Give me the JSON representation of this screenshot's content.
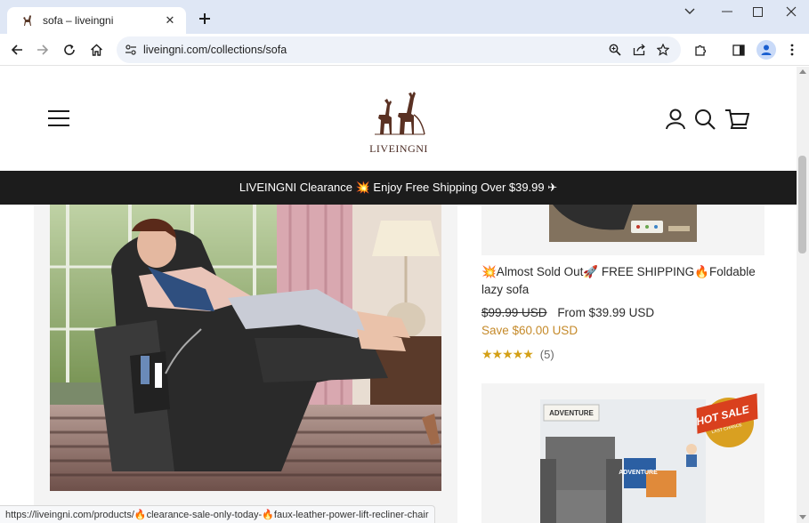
{
  "browser": {
    "tab_title": "sofa – liveingni",
    "url": "liveingni.com/collections/sofa",
    "status_url": "https://liveingni.com/products/🔥clearance-sale-only-today-🔥faux-leather-power-lift-recliner-chair"
  },
  "site": {
    "logo_text": "LIVEINGNI",
    "announcement": "LIVEINGNI Clearance 💥 Enjoy Free Shipping Over $39.99 ✈"
  },
  "product_right": {
    "title": "💥Almost Sold Out🚀 FREE SHIPPING🔥Foldable lazy sofa",
    "compare_price": "$99.99 USD",
    "price": "From $39.99 USD",
    "savings": "Save $60.00 USD",
    "rating_stars": 5,
    "rating_count": "(5)"
  },
  "product_right2": {
    "badge_hot": "HOT SALE",
    "badge_sub": "LAST CHANCE",
    "sign_text": "ADVENTURE",
    "sign_text2": "ADVENTURE"
  },
  "colors": {
    "announce_bg": "#1c1c1c",
    "savings": "#c58a2a",
    "stars": "#d4a017",
    "tabstrip": "#dfe7f5"
  }
}
